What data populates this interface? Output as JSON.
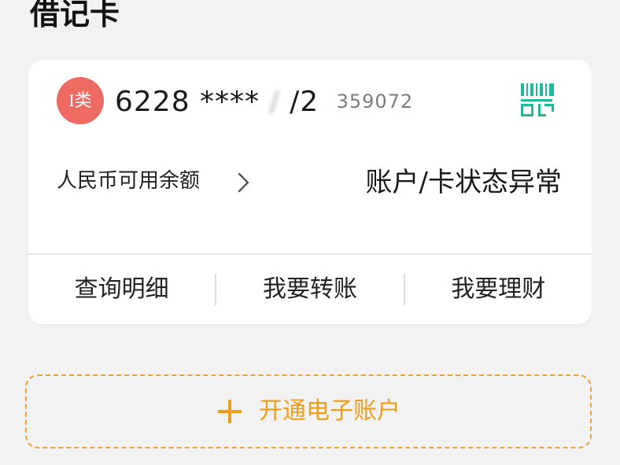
{
  "section": {
    "title": "借记卡"
  },
  "card": {
    "badge": "I类",
    "number_prefix": "6228 ****",
    "number_blurred": "  /",
    "number_mid": "/2",
    "number_suffix": "359072",
    "qr_icon": "qr-code-icon",
    "balance_label": "人民币可用余额",
    "status": "账户/卡状态异常",
    "actions": [
      {
        "label": "查询明细"
      },
      {
        "label": "我要转账"
      },
      {
        "label": "我要理财"
      }
    ],
    "badge_color": "#ee6b63",
    "qr_color": "#1fb89a"
  },
  "open_account": {
    "label": "开通电子账户",
    "accent_color": "#ef9e1a"
  }
}
